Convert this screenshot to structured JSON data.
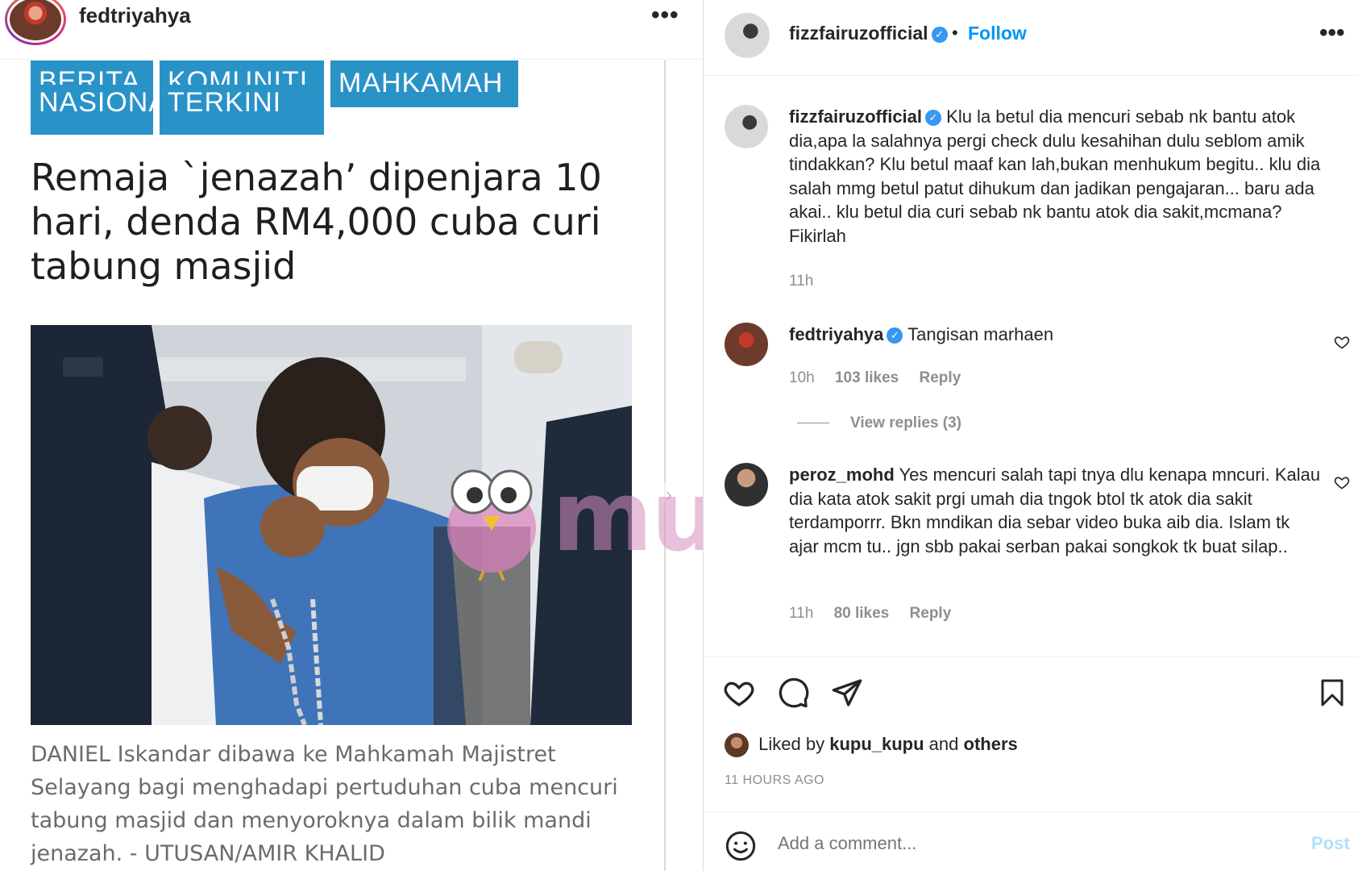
{
  "left_post": {
    "username": "fedtriyahya",
    "more_label": "•••",
    "tags": {
      "tag1_line1": "BERITA",
      "tag1_line2": "NASIONAL",
      "tag2_line1": "KOMUNITI",
      "tag2_line2": "TERKINI",
      "tag3": "MAHKAMAH"
    },
    "headline": "Remaja `jenazah’ dipenjara 10 hari, denda RM4,000 cuba curi tabung masjid",
    "caption": "DANIEL Iskandar dibawa ke Mahkamah Majistret Selayang bagi menghadapi pertuduhan cuba mencuri tabung masjid dan menyoroknya dalam bilik mandi jenazah. - UTUSAN/AMIR KHALID",
    "next_arrow": "›",
    "watermark": "murai"
  },
  "right_panel": {
    "author": "fizzfairuzofficial",
    "separator": "•",
    "follow_label": "Follow",
    "more_label": "•••",
    "verified_glyph": "✓",
    "comments": [
      {
        "username": "fizzfairuzofficial",
        "text": "Klu la betul dia mencuri sebab nk bantu atok dia,apa la salahnya pergi check dulu kesahihan dulu seblom amik tindakkan? Klu betul maaf kan lah,bukan menhukum begitu.. klu dia salah mmg betul patut dihukum dan jadikan pengajaran... baru ada akai.. klu betul dia curi sebab nk bantu atok dia sakit,mcmana? Fikirlah",
        "time": "11h"
      },
      {
        "username": "fedtriyahya",
        "text": "Tangisan marhaen",
        "time": "10h",
        "likes": "103 likes",
        "reply": "Reply",
        "view_replies": "View replies (3)"
      },
      {
        "username": "peroz_mohd",
        "text": "Yes mencuri salah tapi tnya dlu kenapa mncuri. Kalau dia kata atok sakit prgi umah dia tngok btol tk atok dia sakit terdamporrr. Bkn mndikan dia sebar video buka aib dia. Islam tk ajar mcm tu.. jgn sbb pakai serban pakai songkok tk buat silap..",
        "time": "11h",
        "likes": "80 likes",
        "reply": "Reply"
      }
    ],
    "liked_by": {
      "prefix": "Liked by",
      "user": "kupu_kupu",
      "middle": "and",
      "others": "others"
    },
    "time_ago": "11 HOURS AGO",
    "add_comment_placeholder": "Add a comment...",
    "post_label": "Post"
  },
  "colors": {
    "tag_blue": "#2993c8",
    "follow_blue": "#0095f6",
    "muted_text": "#8e8e8e",
    "post_disabled": "#b2dffc"
  }
}
